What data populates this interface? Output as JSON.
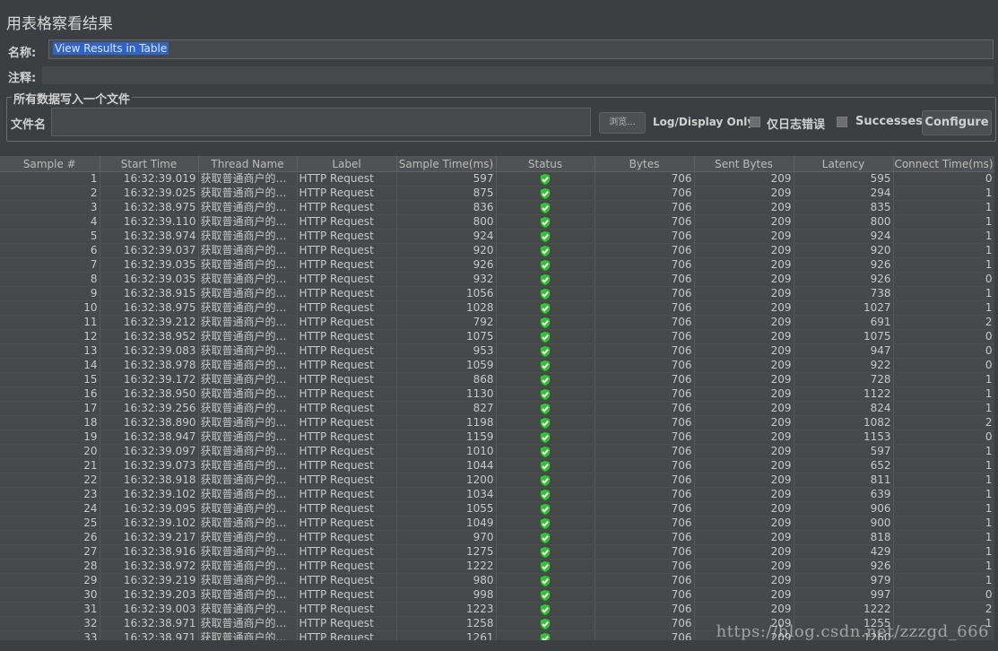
{
  "panel": {
    "title": "用表格察看结果",
    "name_label": "名称:",
    "name_value": "View Results in Table",
    "comment_label": "注释:",
    "file_group_legend": "所有数据写入一个文件",
    "file_label": "文件名",
    "browse_label": "浏览...",
    "log_display_label": "Log/Display Only:",
    "errors_label": "仅日志错误",
    "successes_label": "Successes",
    "configure_label": "Configure"
  },
  "table": {
    "headers": [
      "Sample #",
      "Start Time",
      "Thread Name",
      "Label",
      "Sample Time(ms)",
      "Status",
      "Bytes",
      "Sent Bytes",
      "Latency",
      "Connect Time(ms)"
    ],
    "status_color": "#3dbd3d",
    "rows": [
      [
        "1",
        "16:32:39.019",
        "获取普通商户的套...",
        "HTTP Request",
        "597",
        "706",
        "209",
        "595",
        "0"
      ],
      [
        "2",
        "16:32:39.025",
        "获取普通商户的套...",
        "HTTP Request",
        "875",
        "706",
        "209",
        "294",
        "1"
      ],
      [
        "3",
        "16:32:38.975",
        "获取普通商户的套...",
        "HTTP Request",
        "836",
        "706",
        "209",
        "835",
        "1"
      ],
      [
        "4",
        "16:32:39.110",
        "获取普通商户的套...",
        "HTTP Request",
        "800",
        "706",
        "209",
        "800",
        "1"
      ],
      [
        "5",
        "16:32:38.974",
        "获取普通商户的套...",
        "HTTP Request",
        "924",
        "706",
        "209",
        "924",
        "1"
      ],
      [
        "6",
        "16:32:39.037",
        "获取普通商户的套...",
        "HTTP Request",
        "920",
        "706",
        "209",
        "920",
        "1"
      ],
      [
        "7",
        "16:32:39.035",
        "获取普通商户的套...",
        "HTTP Request",
        "926",
        "706",
        "209",
        "926",
        "1"
      ],
      [
        "8",
        "16:32:39.035",
        "获取普通商户的套...",
        "HTTP Request",
        "932",
        "706",
        "209",
        "926",
        "0"
      ],
      [
        "9",
        "16:32:38.915",
        "获取普通商户的套...",
        "HTTP Request",
        "1056",
        "706",
        "209",
        "738",
        "1"
      ],
      [
        "10",
        "16:32:38.975",
        "获取普通商户的套...",
        "HTTP Request",
        "1028",
        "706",
        "209",
        "1027",
        "1"
      ],
      [
        "11",
        "16:32:39.212",
        "获取普通商户的套...",
        "HTTP Request",
        "792",
        "706",
        "209",
        "691",
        "2"
      ],
      [
        "12",
        "16:32:38.952",
        "获取普通商户的套...",
        "HTTP Request",
        "1075",
        "706",
        "209",
        "1075",
        "0"
      ],
      [
        "13",
        "16:32:39.083",
        "获取普通商户的套...",
        "HTTP Request",
        "953",
        "706",
        "209",
        "947",
        "0"
      ],
      [
        "14",
        "16:32:38.978",
        "获取普通商户的套...",
        "HTTP Request",
        "1059",
        "706",
        "209",
        "922",
        "0"
      ],
      [
        "15",
        "16:32:39.172",
        "获取普通商户的套...",
        "HTTP Request",
        "868",
        "706",
        "209",
        "728",
        "1"
      ],
      [
        "16",
        "16:32:38.950",
        "获取普通商户的套...",
        "HTTP Request",
        "1130",
        "706",
        "209",
        "1122",
        "1"
      ],
      [
        "17",
        "16:32:39.256",
        "获取普通商户的套...",
        "HTTP Request",
        "827",
        "706",
        "209",
        "824",
        "1"
      ],
      [
        "18",
        "16:32:38.890",
        "获取普通商户的套...",
        "HTTP Request",
        "1198",
        "706",
        "209",
        "1082",
        "2"
      ],
      [
        "19",
        "16:32:38.947",
        "获取普通商户的套...",
        "HTTP Request",
        "1159",
        "706",
        "209",
        "1153",
        "0"
      ],
      [
        "20",
        "16:32:39.097",
        "获取普通商户的套...",
        "HTTP Request",
        "1010",
        "706",
        "209",
        "597",
        "1"
      ],
      [
        "21",
        "16:32:39.073",
        "获取普通商户的套...",
        "HTTP Request",
        "1044",
        "706",
        "209",
        "652",
        "1"
      ],
      [
        "22",
        "16:32:38.918",
        "获取普通商户的套...",
        "HTTP Request",
        "1200",
        "706",
        "209",
        "811",
        "1"
      ],
      [
        "23",
        "16:32:39.102",
        "获取普通商户的套...",
        "HTTP Request",
        "1034",
        "706",
        "209",
        "639",
        "1"
      ],
      [
        "24",
        "16:32:39.095",
        "获取普通商户的套...",
        "HTTP Request",
        "1055",
        "706",
        "209",
        "906",
        "1"
      ],
      [
        "25",
        "16:32:39.102",
        "获取普通商户的套...",
        "HTTP Request",
        "1049",
        "706",
        "209",
        "900",
        "1"
      ],
      [
        "26",
        "16:32:39.217",
        "获取普通商户的套...",
        "HTTP Request",
        "970",
        "706",
        "209",
        "818",
        "1"
      ],
      [
        "27",
        "16:32:38.916",
        "获取普通商户的套...",
        "HTTP Request",
        "1275",
        "706",
        "209",
        "429",
        "1"
      ],
      [
        "28",
        "16:32:38.972",
        "获取普通商户的套...",
        "HTTP Request",
        "1222",
        "706",
        "209",
        "926",
        "1"
      ],
      [
        "29",
        "16:32:39.219",
        "获取普通商户的套...",
        "HTTP Request",
        "980",
        "706",
        "209",
        "979",
        "1"
      ],
      [
        "30",
        "16:32:39.203",
        "获取普通商户的套...",
        "HTTP Request",
        "998",
        "706",
        "209",
        "997",
        "0"
      ],
      [
        "31",
        "16:32:39.003",
        "获取普通商户的套...",
        "HTTP Request",
        "1223",
        "706",
        "209",
        "1222",
        "2"
      ],
      [
        "32",
        "16:32:38.971",
        "获取普通商户的套...",
        "HTTP Request",
        "1258",
        "706",
        "209",
        "1255",
        "1"
      ],
      [
        "33",
        "16:32:38.971",
        "获取普通商户的套...",
        "HTTP Request",
        "1261",
        "706",
        "209",
        "1260",
        ""
      ]
    ]
  },
  "watermark": "https://blog.csdn.net/zzzgd_666"
}
